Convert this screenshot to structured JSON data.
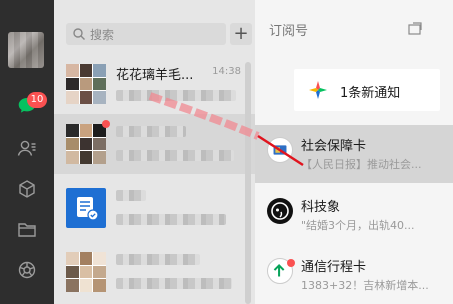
{
  "sidebar": {
    "unread_badge": "10",
    "icons": [
      "chat-icon",
      "contacts-icon",
      "cube-icon",
      "folder-icon",
      "moments-icon"
    ]
  },
  "chatlist": {
    "search_placeholder": "搜索",
    "add_label": "+",
    "items": [
      {
        "name": "花花璃羊毛...",
        "time": "14:38"
      },
      {
        "name": "",
        "time": ""
      },
      {
        "name": "",
        "time": ""
      },
      {
        "name": "",
        "time": ""
      }
    ]
  },
  "subscriptions": {
    "title": "订阅号",
    "notify": "1条新通知",
    "items": [
      {
        "name": "社会保障卡",
        "preview": "【人民日报】推动社会..."
      },
      {
        "name": "科技象",
        "preview": "\"结婚3个月，出轨40..."
      },
      {
        "name": "通信行程卡",
        "preview": "1383+32！吉林新增本..."
      }
    ]
  },
  "colors": {
    "sidebar_bg": "#2e2e2e",
    "badge": "#fa5151",
    "accent_green": "#07c160",
    "annotation_red": "#e0141e"
  }
}
